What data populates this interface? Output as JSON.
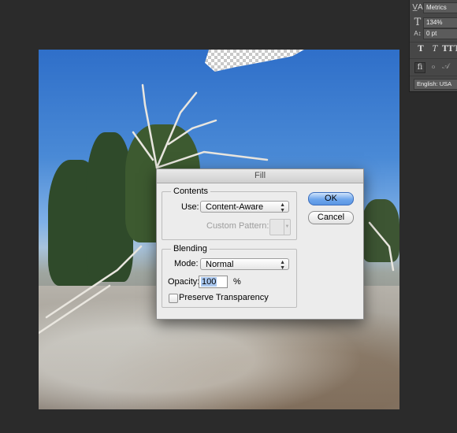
{
  "character_panel": {
    "font_style": "Metrics",
    "font_size": "134%",
    "tracking": "0 pt",
    "language": "English: USA",
    "icons": [
      "kerning-icon",
      "font-size-icon",
      "tracking-icon"
    ],
    "style_buttons": [
      "T",
      "T",
      "TT",
      "T"
    ],
    "glyph_buttons": [
      "ﬁ",
      "ℴ",
      "𝒜"
    ]
  },
  "fill_dialog": {
    "title": "Fill",
    "contents_legend": "Contents",
    "use_label": "Use:",
    "use_value": "Content-Aware",
    "custom_pattern_label": "Custom Pattern:",
    "blending_legend": "Blending",
    "mode_label": "Mode:",
    "mode_value": "Normal",
    "opacity_label": "Opacity:",
    "opacity_value": "100",
    "opacity_unit": "%",
    "preserve_transparency_label": "Preserve Transparency",
    "preserve_transparency_checked": false,
    "ok_label": "OK",
    "cancel_label": "Cancel"
  }
}
